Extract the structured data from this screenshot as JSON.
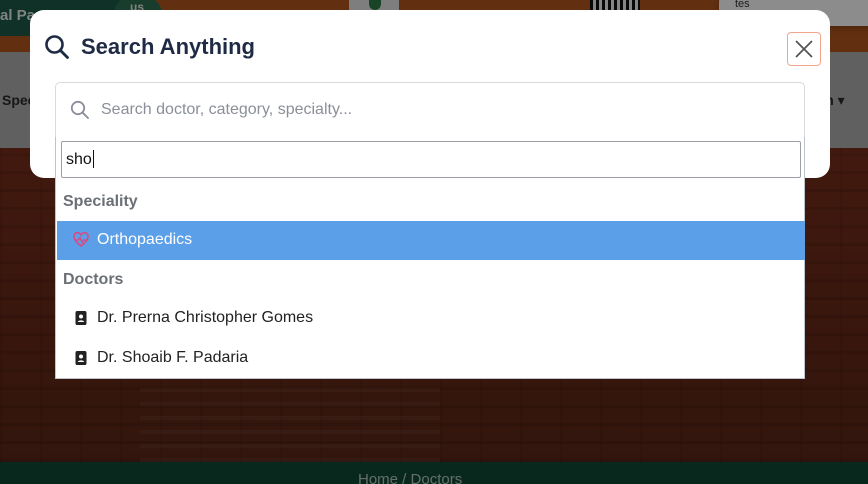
{
  "background": {
    "topbar_text": "al Pa",
    "logo_text": "us",
    "nav_left": "Spec",
    "nav_right": "rch ▾",
    "toast_text": "tes",
    "breadcrumb": "Home  /  Doctors"
  },
  "modal": {
    "title": "Search Anything",
    "search_placeholder": "Search doctor, category, specialty...",
    "search_value": ""
  },
  "dropdown": {
    "filter_value": "sho",
    "groups": [
      {
        "label": "Speciality",
        "items": [
          {
            "label": "Orthopaedics",
            "icon": "heartbeat-icon",
            "active": true
          }
        ]
      },
      {
        "label": "Doctors",
        "items": [
          {
            "label": "Dr. Prerna Christopher Gomes",
            "icon": "id-badge-icon",
            "active": false
          },
          {
            "label": "Dr. Shoaib F. Padaria",
            "icon": "id-badge-icon",
            "active": false
          }
        ]
      }
    ]
  },
  "colors": {
    "accent": "#5a9fe8",
    "title": "#1f2a44",
    "close_border": "#f3a68c",
    "heartbeat_icon": "#e0457b",
    "footer": "#0f4a35"
  }
}
